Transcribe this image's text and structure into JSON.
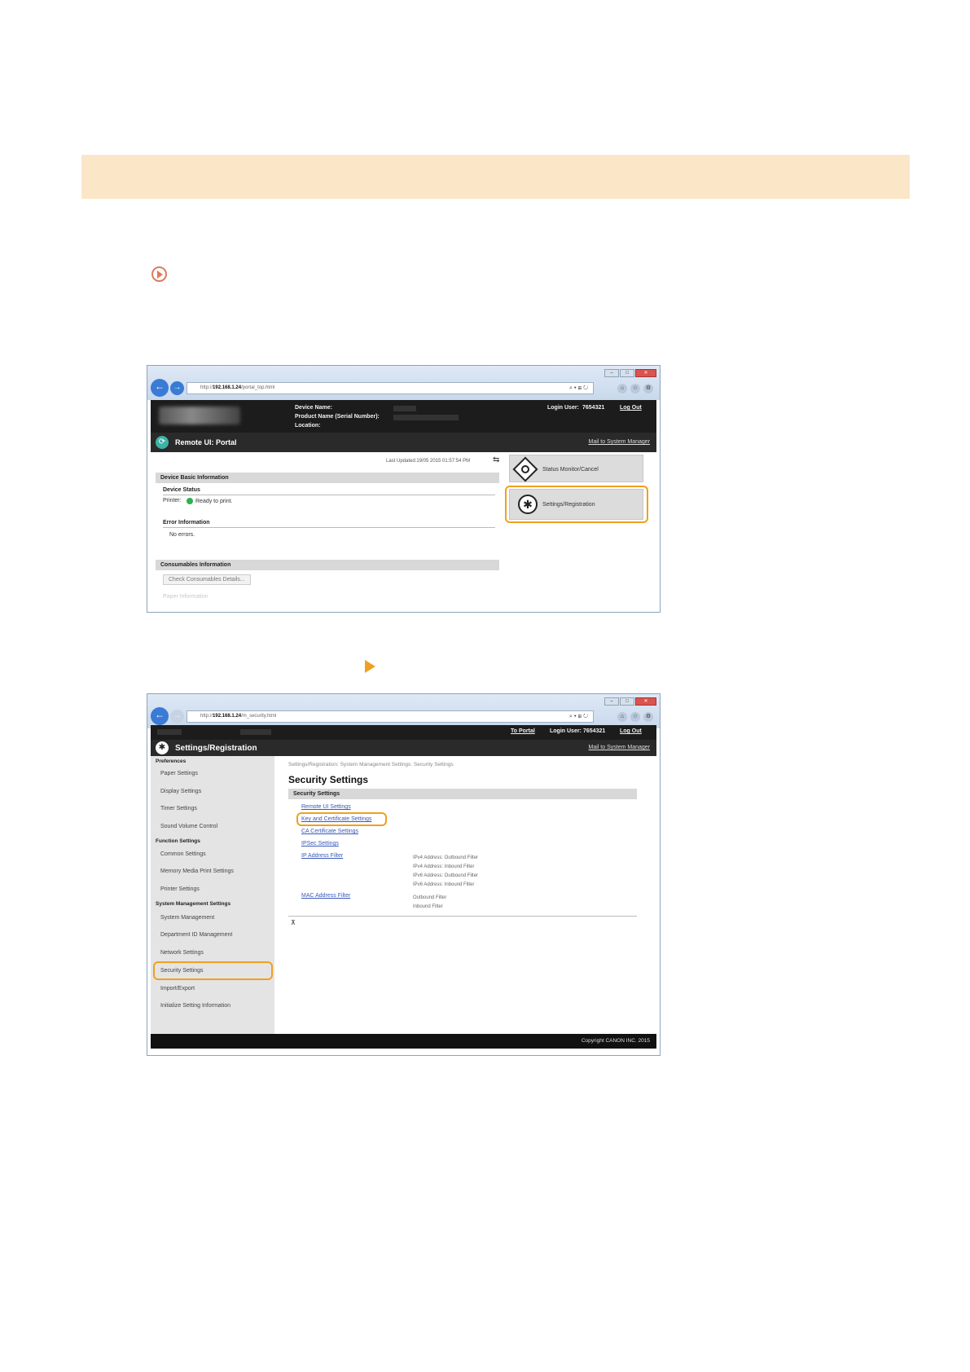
{
  "page": {
    "banner_color": "#fce6c8",
    "accent": "#f0a020"
  },
  "browser1": {
    "url_prefix": "http://",
    "url_host": "192.168.1.24",
    "url_path": "/portal_top.html",
    "addr_tools": "⌕ ▾ ⊞ ↻",
    "win_buttons": [
      "–",
      "□",
      "✕"
    ],
    "device_name_label": "Device Name:",
    "product_name_label": "Product Name (Serial Number):",
    "location_label": "Location:",
    "login_user_label": "Login User:",
    "login_user_value": "7654321",
    "logout": "Log Out",
    "portal_title": "Remote UI: Portal",
    "mail_link": "Mail to System Manager",
    "last_updated": "Last Updated:19/05 2015 01:57:54 PM",
    "device_basic_info": "Device Basic Information",
    "device_status": "Device Status",
    "printer_label": "Printer:",
    "printer_status": "Ready to print.",
    "error_info": "Error Information",
    "no_errors": "No errors.",
    "consumables_info": "Consumables Information",
    "check_consumables": "Check Consumables Details...",
    "paper_info": "Paper Information",
    "status_monitor": "Status Monitor/Cancel",
    "settings_registration": "Settings/Registration"
  },
  "browser2": {
    "url_prefix": "http://",
    "url_host": "192.168.1.24",
    "url_path": "/m_security.html",
    "to_portal": "To Portal",
    "login_user_label": "Login User:",
    "login_user_value": "7654321",
    "logout": "Log Out",
    "title": "Settings/Registration",
    "mail_link": "Mail to System Manager",
    "sidebar": {
      "preferences": "Preferences",
      "paper_settings": "Paper Settings",
      "display_settings": "Display Settings",
      "timer_settings": "Timer Settings",
      "sound_volume": "Sound Volume Control",
      "function_settings": "Function Settings",
      "common_settings": "Common Settings",
      "memory_media": "Memory Media Print Settings",
      "printer_settings": "Printer Settings",
      "system_mgmt_settings": "System Management Settings",
      "system_management": "System Management",
      "department_id": "Department ID Management",
      "network_settings": "Network Settings",
      "security_settings": "Security Settings",
      "import_export": "Import/Export",
      "initialize": "Initialize Setting Information"
    },
    "breadcrumb": "Settings/Registration: System Management Settings: Security Settings",
    "page_title": "Security Settings",
    "section_title": "Security Settings",
    "links": {
      "remote_ui": "Remote UI Settings",
      "key_cert": "Key and Certificate Settings",
      "ca_cert": "CA Certificate Settings",
      "ipsec": "IPSec Settings",
      "ip_filter": "IP Address Filter",
      "mac_filter": "MAC Address Filter"
    },
    "ip_filters": [
      "IPv4 Address: Outbound Filter",
      "IPv4 Address: Inbound Filter",
      "IPv6 Address: Outbound Filter",
      "IPv6 Address: Inbound Filter"
    ],
    "mac_filters": [
      "Outbound Filter",
      "Inbound Filter"
    ],
    "copyright": "Copyright CANON INC. 2015"
  }
}
